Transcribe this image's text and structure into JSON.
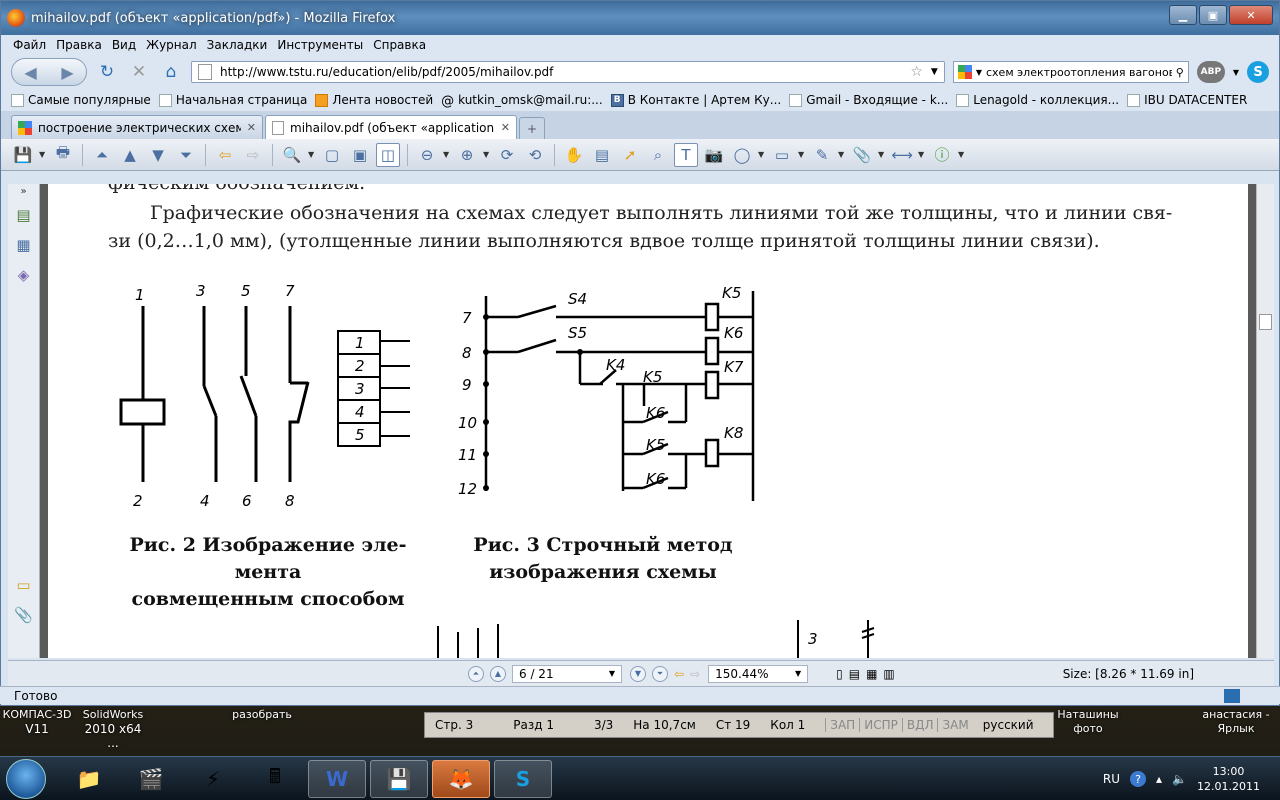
{
  "window": {
    "title": "mihailov.pdf (объект «application/pdf») - Mozilla Firefox"
  },
  "menu": [
    "Файл",
    "Правка",
    "Вид",
    "Журнал",
    "Закладки",
    "Инструменты",
    "Справка"
  ],
  "nav": {
    "url": "http://www.tstu.ru/education/elib/pdf/2005/mihailov.pdf",
    "search_value": "схем электроотопления вагонов",
    "abp": "ABP"
  },
  "bookmarks": [
    {
      "label": "Самые популярные",
      "icon": "page-icon"
    },
    {
      "label": "Начальная страница",
      "icon": "page-icon"
    },
    {
      "label": "Лента новостей",
      "icon": "rss-icon"
    },
    {
      "label": "kutkin_omsk@mail.ru:...",
      "icon": "at-icon"
    },
    {
      "label": "В Контакте | Артем Ку...",
      "icon": "vk-icon"
    },
    {
      "label": "Gmail - Входящие - k...",
      "icon": "google-icon"
    },
    {
      "label": "Lenagold - коллекция...",
      "icon": "page-icon"
    },
    {
      "label": "IBU DATACENTER",
      "icon": "page-icon"
    }
  ],
  "tabs": [
    {
      "label": "построение электрических схем в...",
      "active": false
    },
    {
      "label": "mihailov.pdf (объект «application...",
      "active": true
    }
  ],
  "document": {
    "line0": "фическим обозначением.",
    "line1": "Графические обозначения на схемах следует выполнять линиями той же толщины, что и линии свя-",
    "line2": "зи (0,2…1,0 мм), (утолщенные линии выполняются вдвое толще принятой толщины линии связи).",
    "fig2": {
      "labels_top": [
        "1",
        "3",
        "5",
        "7"
      ],
      "labels_bottom": [
        "2",
        "4",
        "6",
        "8"
      ],
      "terminals": [
        "1",
        "2",
        "3",
        "4",
        "5"
      ],
      "caption1": "Рис. 2   Изображение эле-",
      "caption2": "мента",
      "caption3": "совмещенным способом"
    },
    "fig3": {
      "rows": [
        "7",
        "8",
        "9",
        "10",
        "11",
        "12"
      ],
      "switches": [
        "S4",
        "S5",
        "K4",
        "K5",
        "K6",
        "K5",
        "K6"
      ],
      "coils": [
        "K5",
        "K6",
        "K7",
        "K8"
      ],
      "caption1": "Рис. 3   Строчный метод",
      "caption2": "изображения схемы"
    },
    "next_fig_label": "3"
  },
  "pdfnav": {
    "page": "6 / 21",
    "zoom": "150.44%",
    "size": "Size: [8.26 * 11.69 in]"
  },
  "status": "Готово",
  "desktop": {
    "icons": [
      {
        "line1": "КОМПАС-3D",
        "line2": "V11"
      },
      {
        "line1": "SolidWorks",
        "line2": "2010 x64 ..."
      },
      {
        "line1": "разобрать",
        "line2": ""
      },
      {
        "line1": "Наташины",
        "line2": "фото"
      },
      {
        "line1": "анастасия -",
        "line2": "Ярлык"
      }
    ],
    "kompas_status": {
      "page": "Стр. 3",
      "section": "Разд 1",
      "pages": "3/3",
      "pos": "На 10,7см",
      "line": "Ст 19",
      "col": "Кол 1",
      "flags": [
        "ЗАП",
        "ИСПР",
        "ВДЛ",
        "ЗАМ"
      ],
      "lang": "русский"
    }
  },
  "taskbar": {
    "lang": "RU",
    "time": "13:00",
    "date": "12.01.2011"
  }
}
